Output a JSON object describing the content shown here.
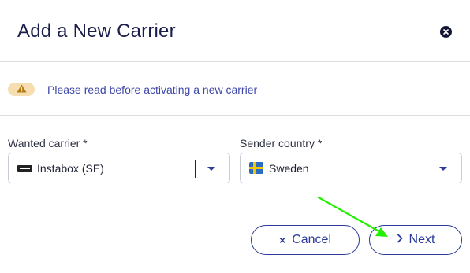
{
  "modal": {
    "title": "Add a New Carrier",
    "close_icon": "close-icon"
  },
  "notice": {
    "icon": "warning-icon",
    "text": "Please read before activating a new carrier"
  },
  "fields": {
    "carrier": {
      "label": "Wanted carrier *",
      "value": "Instabox (SE)",
      "icon": "instabox-logo-icon"
    },
    "country": {
      "label": "Sender country *",
      "value": "Sweden",
      "icon": "sweden-flag-icon"
    }
  },
  "footer": {
    "cancel_label": "Cancel",
    "cancel_icon": "x-icon",
    "next_label": "Next",
    "next_icon": "chevron-right-icon"
  },
  "colors": {
    "accent": "#2a3b9a",
    "warning_bg": "#f6deb0",
    "annotation_arrow": "#22f000"
  }
}
